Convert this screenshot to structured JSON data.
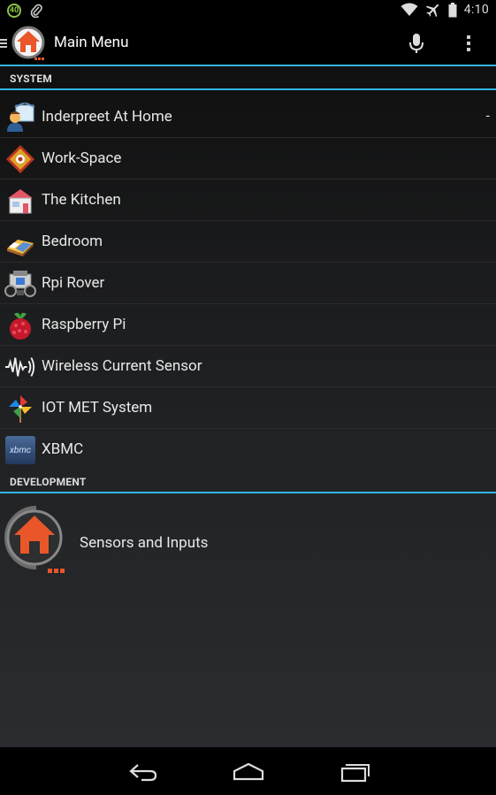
{
  "status_bar": {
    "notification_badge": "40",
    "time": "4:10",
    "icons": [
      "paperclip-icon",
      "wifi-icon",
      "airplane-icon",
      "battery-icon"
    ]
  },
  "action_bar": {
    "title": "Main Menu",
    "icons": [
      "hamburger-icon",
      "app-logo-icon",
      "microphone-icon",
      "overflow-menu-icon"
    ]
  },
  "sections": {
    "system": "SYSTEM",
    "development": "DEVELOPMENT"
  },
  "system_items": [
    {
      "label": "Inderpreet At Home",
      "trail": "-",
      "icon": "person-home-icon"
    },
    {
      "label": "Work-Space",
      "trail": "",
      "icon": "workspace-icon"
    },
    {
      "label": "The Kitchen",
      "trail": "",
      "icon": "kitchen-icon"
    },
    {
      "label": "Bedroom",
      "trail": "",
      "icon": "bed-icon"
    },
    {
      "label": "Rpi Rover",
      "trail": "",
      "icon": "rover-icon"
    },
    {
      "label": "Raspberry Pi",
      "trail": "",
      "icon": "raspberry-icon"
    },
    {
      "label": "Wireless Current Sensor",
      "trail": "",
      "icon": "signal-wave-icon"
    },
    {
      "label": "IOT MET System",
      "trail": "",
      "icon": "pinwheel-icon"
    },
    {
      "label": "XBMC",
      "trail": "",
      "icon": "xbmc-icon",
      "icon_text": "xbmc"
    }
  ],
  "development_items": [
    {
      "label": "Sensors and Inputs",
      "icon": "app-logo-icon"
    }
  ],
  "colors": {
    "accent": "#33b5e5",
    "logo_orange": "#e8562a"
  }
}
